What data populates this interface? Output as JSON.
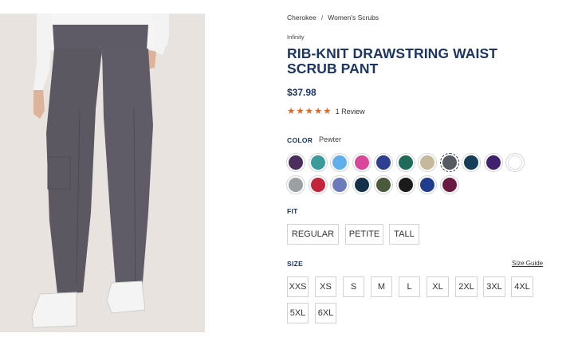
{
  "breadcrumb": {
    "items": [
      "Cherokee",
      "Women's Scrubs"
    ],
    "separator": "/"
  },
  "product": {
    "brand": "Infinity",
    "title": "RIB-KNIT DRAWSTRING WAIST SCRUB PANT",
    "price": "$37.98",
    "rating": {
      "stars": 5,
      "review_text": "1 Review",
      "star_color": "#d86b2a"
    }
  },
  "color": {
    "label": "COLOR",
    "selected": "Pewter",
    "swatches": [
      {
        "name": "purple",
        "hex": "#4a2f5e"
      },
      {
        "name": "teal",
        "hex": "#3a9a9c"
      },
      {
        "name": "sky-blue",
        "hex": "#5fb0ea"
      },
      {
        "name": "pink",
        "hex": "#d9479a"
      },
      {
        "name": "royal-blue",
        "hex": "#2f3f8f"
      },
      {
        "name": "hunter-green",
        "hex": "#1f6b5a"
      },
      {
        "name": "khaki",
        "hex": "#c5b89c"
      },
      {
        "name": "pewter",
        "hex": "#555a63",
        "selected": true
      },
      {
        "name": "navy-teal",
        "hex": "#173e59"
      },
      {
        "name": "eggplant",
        "hex": "#3f2170"
      },
      {
        "name": "white",
        "hex": "#ffffff"
      },
      {
        "name": "grey",
        "hex": "#9aa0a3"
      },
      {
        "name": "red",
        "hex": "#c4243a"
      },
      {
        "name": "periwinkle",
        "hex": "#6d79bd"
      },
      {
        "name": "dark-navy",
        "hex": "#13314a"
      },
      {
        "name": "olive",
        "hex": "#4a5a3a"
      },
      {
        "name": "black",
        "hex": "#1b1b1b"
      },
      {
        "name": "blue",
        "hex": "#1f3c8f"
      },
      {
        "name": "wine",
        "hex": "#6a1a40"
      }
    ]
  },
  "fit": {
    "label": "FIT",
    "options": [
      "REGULAR",
      "PETITE",
      "TALL"
    ]
  },
  "size": {
    "label": "SIZE",
    "guide_label": "Size Guide",
    "options": [
      "XXS",
      "XS",
      "S",
      "M",
      "L",
      "XL",
      "2XL",
      "3XL",
      "4XL",
      "5XL",
      "6XL"
    ]
  }
}
